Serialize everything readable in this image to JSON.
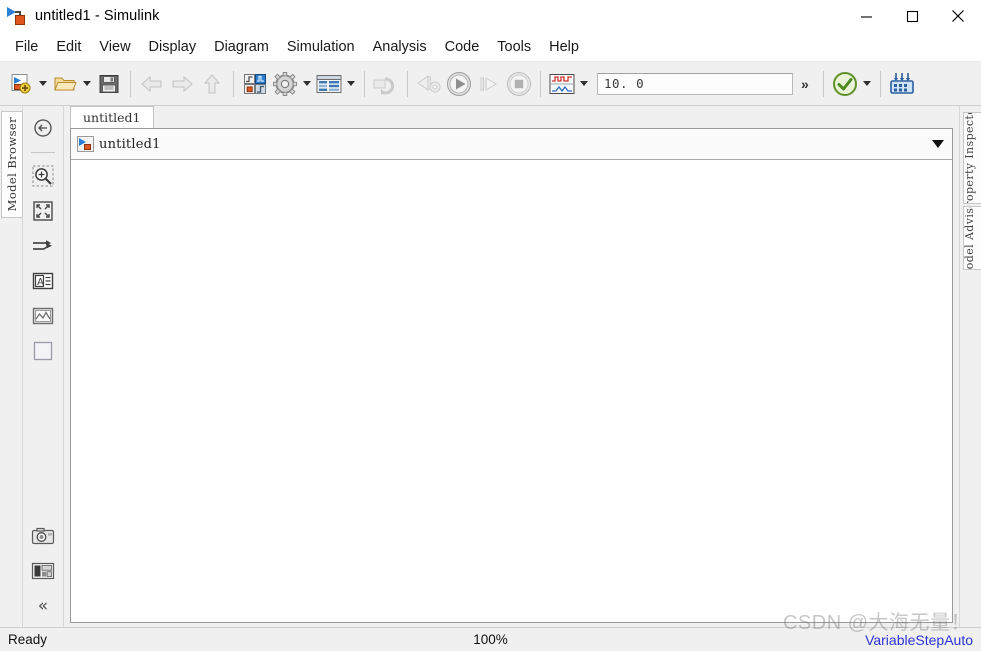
{
  "window": {
    "title": "untitled1 - Simulink",
    "app_icon": "simulink-model-icon",
    "controls": {
      "minimize": "minimize-icon",
      "maximize": "maximize-icon",
      "close": "close-icon"
    }
  },
  "menubar": {
    "items": [
      {
        "label": "File"
      },
      {
        "label": "Edit"
      },
      {
        "label": "View"
      },
      {
        "label": "Display"
      },
      {
        "label": "Diagram"
      },
      {
        "label": "Simulation"
      },
      {
        "label": "Analysis"
      },
      {
        "label": "Code"
      },
      {
        "label": "Tools"
      },
      {
        "label": "Help"
      }
    ]
  },
  "toolbar": {
    "new_model": "new-model-icon",
    "new_model_dropdown": "chevron-down-icon",
    "open": "open-folder-icon",
    "open_dropdown": "chevron-down-icon",
    "save": "save-floppy-icon",
    "back": "navigate-back-icon",
    "forward": "navigate-forward-icon",
    "up": "navigate-up-icon",
    "library_browser": "library-browser-icon",
    "model_configuration": "gear-icon",
    "model_configuration_dropdown": "chevron-down-icon",
    "model_explorer": "model-explorer-icon",
    "model_explorer_dropdown": "chevron-down-icon",
    "update_model": "refresh-model-icon",
    "fast_restart": "fast-restart-icon",
    "run": "run-icon",
    "step_forward": "step-forward-icon",
    "stop": "stop-icon",
    "simulation_data_inspector": "signal-scope-icon",
    "simulation_data_inspector_dropdown": "chevron-down-icon",
    "stop_time_value": "10. 0",
    "stop_time_placeholder": "10.0",
    "overflow": "»",
    "model_advisor": "check-circle-icon",
    "model_advisor_dropdown": "chevron-down-icon",
    "hardware": "hardware-chip-icon"
  },
  "left_panel": {
    "tab_label": "Model Browser"
  },
  "rail": {
    "items": [
      {
        "name": "navigate-up-icon"
      },
      {
        "name": "zoom-region-icon"
      },
      {
        "name": "fit-to-view-icon"
      },
      {
        "name": "signal-routing-icon"
      },
      {
        "name": "annotation-text-icon"
      },
      {
        "name": "annotation-image-icon"
      },
      {
        "name": "annotation-area-icon"
      }
    ],
    "bottom_items": [
      {
        "name": "camera-snapshot-icon"
      },
      {
        "name": "legend-layout-icon"
      },
      {
        "name": "collapse-rail-icon"
      }
    ],
    "collapse_glyph": "«"
  },
  "document": {
    "tab_label": "untitled1",
    "breadcrumb": {
      "icon": "simulink-model-icon",
      "label": "untitled1",
      "dropdown": "chevron-down-icon"
    }
  },
  "right_panel": {
    "tabs": [
      {
        "label": "Property Inspector"
      },
      {
        "label": "Model Advisor"
      }
    ]
  },
  "statusbar": {
    "status": "Ready",
    "zoom": "100%",
    "solver": "VariableStepAuto"
  },
  "watermark": {
    "text": "CSDN @大海无量！"
  },
  "colors": {
    "accent_blue": "#2b7fd4",
    "block_orange": "#e0561f",
    "solver_blue": "#2b35d6",
    "chrome": "#f0f0f0"
  }
}
